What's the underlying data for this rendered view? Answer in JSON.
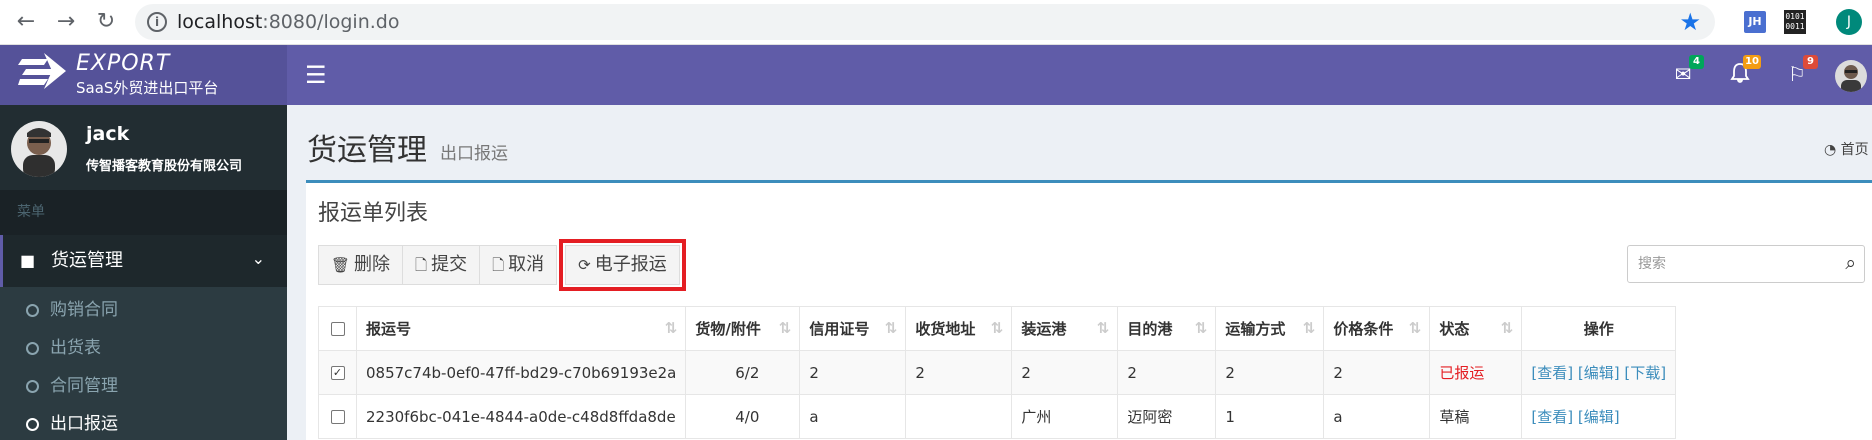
{
  "browser": {
    "url_host": "localhost",
    "url_path": ":8080/login.do",
    "ext1_label": "JH",
    "ext2_label": "0101 0011",
    "profile_initial": "J"
  },
  "header": {
    "logo_title": "EXPORT",
    "logo_subtitle": "SaaS外贸进出口平台",
    "badges": {
      "mail": "4",
      "bell": "10",
      "flag": "9"
    },
    "badge_colors": {
      "mail": "#00a65a",
      "bell": "#f39c12",
      "flag": "#dd4b39"
    }
  },
  "sidebar": {
    "user_name": "jack",
    "company": "传智播客教育股份有限公司",
    "section_label": "菜单",
    "main_item": "货运管理",
    "items": [
      {
        "label": "购销合同"
      },
      {
        "label": "出货表"
      },
      {
        "label": "合同管理"
      },
      {
        "label": "出口报运"
      }
    ]
  },
  "content": {
    "title": "货运管理",
    "subtitle": "出口报运",
    "breadcrumb_home": "首页"
  },
  "box": {
    "title": "报运单列表",
    "buttons": {
      "delete": "删除",
      "submit": "提交",
      "cancel": "取消",
      "eship": "电子报运"
    },
    "search_placeholder": "搜索",
    "columns": [
      "报运号",
      "货物/附件",
      "信用证号",
      "收货地址",
      "装运港",
      "目的港",
      "运输方式",
      "价格条件",
      "状态",
      "操作"
    ],
    "rows": [
      {
        "checked": true,
        "id": "0857c74b-0ef0-47ff-bd29-c70b69193e2a",
        "goods": "6/2",
        "lc": "2",
        "addr": "2",
        "ship_port": "2",
        "dest_port": "2",
        "transport": "2",
        "price": "2",
        "status": "已报运",
        "ops": [
          "[查看]",
          "[编辑]",
          "[下载]"
        ]
      },
      {
        "checked": false,
        "id": "2230f6bc-041e-4844-a0de-c48d8ffda8de",
        "goods": "4/0",
        "lc": "a",
        "addr": "",
        "ship_port": "广州",
        "dest_port": "迈阿密",
        "transport": "1",
        "price": "a",
        "status": "草稿",
        "ops": [
          "[查看]",
          "[编辑]"
        ]
      }
    ]
  }
}
